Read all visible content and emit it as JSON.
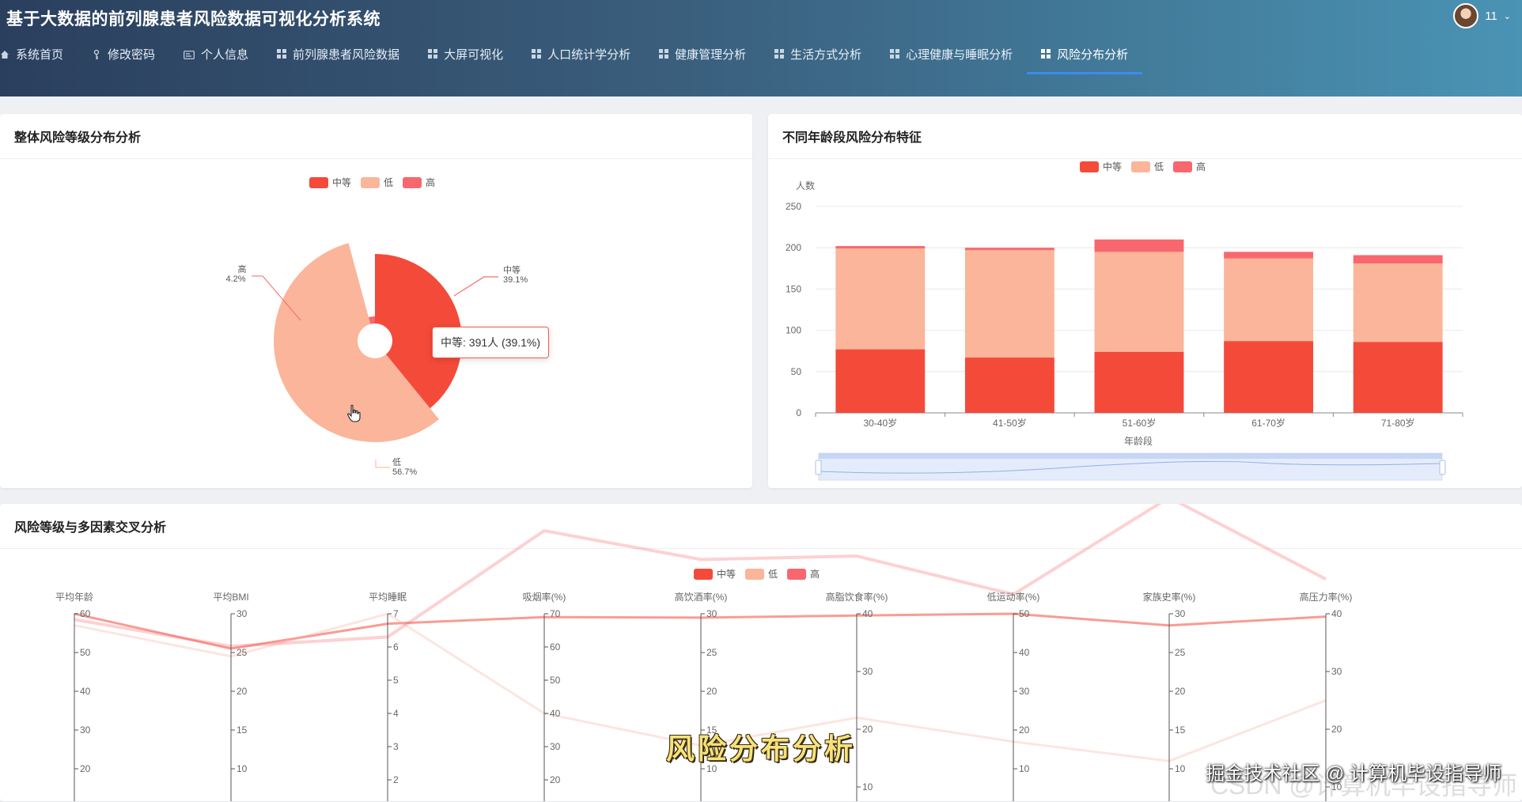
{
  "header": {
    "title": "基于大数据的前列腺患者风险数据可视化分析系统",
    "user_name": "11"
  },
  "nav": [
    {
      "label": "系统首页",
      "icon": "home-icon"
    },
    {
      "label": "修改密码",
      "icon": "key-icon"
    },
    {
      "label": "个人信息",
      "icon": "id-card-icon"
    },
    {
      "label": "前列腺患者风险数据",
      "icon": "grid-icon"
    },
    {
      "label": "大屏可视化",
      "icon": "grid-icon"
    },
    {
      "label": "人口统计学分析",
      "icon": "grid-icon"
    },
    {
      "label": "健康管理分析",
      "icon": "grid-icon"
    },
    {
      "label": "生活方式分析",
      "icon": "grid-icon"
    },
    {
      "label": "心理健康与睡眠分析",
      "icon": "grid-icon"
    },
    {
      "label": "风险分布分析",
      "icon": "grid-icon",
      "active": true
    }
  ],
  "colors": {
    "medium": "#f44a3a",
    "low": "#fbb59a",
    "high": "#f8676e",
    "accent": "#3b8cf3"
  },
  "legend": {
    "medium": "中等",
    "low": "低",
    "high": "高"
  },
  "panel1": {
    "title": "整体风险等级分布分析",
    "tooltip": "中等: 391人 (39.1%)",
    "labels": {
      "high_name": "高",
      "high_pct": "4.2%",
      "medium_name": "中等",
      "medium_pct": "39.1%",
      "low_name": "低",
      "low_pct": "56.7%"
    }
  },
  "panel2": {
    "title": "不同年龄段风险分布特征",
    "ylabel": "人数",
    "xlabel": "年龄段"
  },
  "panel3": {
    "title": "风险等级与多因素交叉分析"
  },
  "overlay": {
    "caption": "风险分布分析",
    "watermark": "掘金技术社区 @ 计算机毕设指导师",
    "watermark_bg": "CSDN @计算机毕设指导师"
  },
  "chart_data": [
    {
      "type": "pie",
      "rose": true,
      "series": [
        {
          "name": "中等",
          "value": 391,
          "percent": 39.1
        },
        {
          "name": "低",
          "value": 567,
          "percent": 56.7
        },
        {
          "name": "高",
          "value": 42,
          "percent": 4.2
        }
      ]
    },
    {
      "type": "bar",
      "stacked": true,
      "categories": [
        "30-40岁",
        "41-50岁",
        "51-60岁",
        "61-70岁",
        "71-80岁"
      ],
      "series": [
        {
          "name": "中等",
          "values": [
            77,
            67,
            74,
            87,
            86
          ]
        },
        {
          "name": "低",
          "values": [
            122,
            130,
            121,
            100,
            95
          ]
        },
        {
          "name": "高",
          "values": [
            3,
            3,
            15,
            8,
            10
          ]
        }
      ],
      "ylabel": "人数",
      "xlabel": "年龄段",
      "ylim": [
        0,
        250
      ],
      "yticks": [
        0,
        50,
        100,
        150,
        200,
        250
      ],
      "legend": "top-center"
    },
    {
      "type": "parallel",
      "axes": [
        {
          "name": "平均年龄",
          "ticks": [
            60,
            50,
            40,
            30,
            20
          ],
          "range": [
            20,
            60
          ]
        },
        {
          "name": "平均BMI",
          "ticks": [
            30,
            25,
            20,
            15,
            10
          ],
          "range": [
            10,
            30
          ]
        },
        {
          "name": "平均睡眠",
          "ticks": [
            7,
            6,
            5,
            4,
            3,
            2
          ],
          "range": [
            2,
            7
          ]
        },
        {
          "name": "吸烟率(%)",
          "ticks": [
            70,
            60,
            50,
            40,
            30,
            20
          ],
          "range": [
            20,
            70
          ]
        },
        {
          "name": "高饮酒率(%)",
          "ticks": [
            30,
            25,
            20,
            15,
            10
          ],
          "range": [
            10,
            30
          ]
        },
        {
          "name": "高脂饮食率(%)",
          "ticks": [
            40,
            30,
            20,
            10
          ],
          "range": [
            10,
            40
          ]
        },
        {
          "name": "低运动率(%)",
          "ticks": [
            50,
            40,
            30,
            20,
            10
          ],
          "range": [
            10,
            50
          ]
        },
        {
          "name": "家族史率(%)",
          "ticks": [
            30,
            25,
            20,
            15,
            10
          ],
          "range": [
            10,
            30
          ]
        },
        {
          "name": "高压力率(%)",
          "ticks": [
            40,
            30,
            20,
            10
          ],
          "range": [
            10,
            40
          ]
        }
      ],
      "series": [
        {
          "name": "中等",
          "values": [
            60,
            25.5,
            6.7,
            69,
            29.5,
            39.7,
            50,
            28.5,
            39.5
          ]
        },
        {
          "name": "低",
          "values": [
            57,
            24.5,
            7,
            40,
            13,
            22,
            17,
            11,
            25
          ]
        },
        {
          "name": "高",
          "values": [
            58.5,
            25.8,
            6.3,
            95,
            37,
            50,
            55,
            45,
            46
          ]
        }
      ]
    }
  ]
}
